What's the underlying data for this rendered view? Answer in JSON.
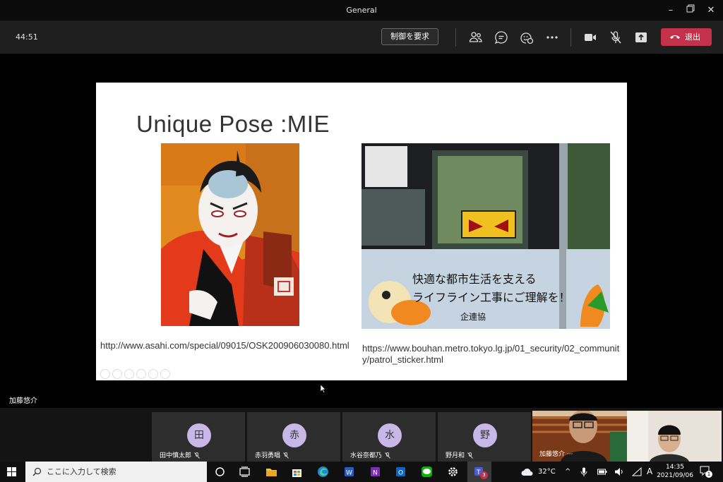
{
  "window": {
    "title": "General"
  },
  "toolbar": {
    "timer": "44:51",
    "request_control": "制御を要求",
    "leave_label": "退出"
  },
  "slide": {
    "title": "Unique Pose :MIE",
    "url1": "http://www.asahi.com/special/09015/OSK200906030080.html",
    "url2": "https://www.bouhan.metro.tokyo.lg.jp/01_security/02_community/patrol_sticker.html",
    "sign_line1": "快適な都市生活を支える",
    "sign_line2": "ライフライン工事にご理解を！",
    "sign_line3": "企連協"
  },
  "presenter_name": "加藤悠介",
  "participants": [
    {
      "initial": "田",
      "name": "田中慎太郎"
    },
    {
      "initial": "赤",
      "name": "赤羽勇唱"
    },
    {
      "initial": "水",
      "name": "水谷奈都乃"
    },
    {
      "initial": "野",
      "name": "野月和"
    }
  ],
  "video_tile": {
    "name": "加藤悠介"
  },
  "taskbar": {
    "search_placeholder": "ここに入力して検索",
    "temperature": "32°C",
    "ime": "A",
    "time": "14:35",
    "date": "2021/09/06",
    "notification_count": "1",
    "teams_badge": "3"
  },
  "colors": {
    "leave": "#c4314b",
    "avatar": "#c8b8e8",
    "toolbar": "#1f1f1f"
  }
}
